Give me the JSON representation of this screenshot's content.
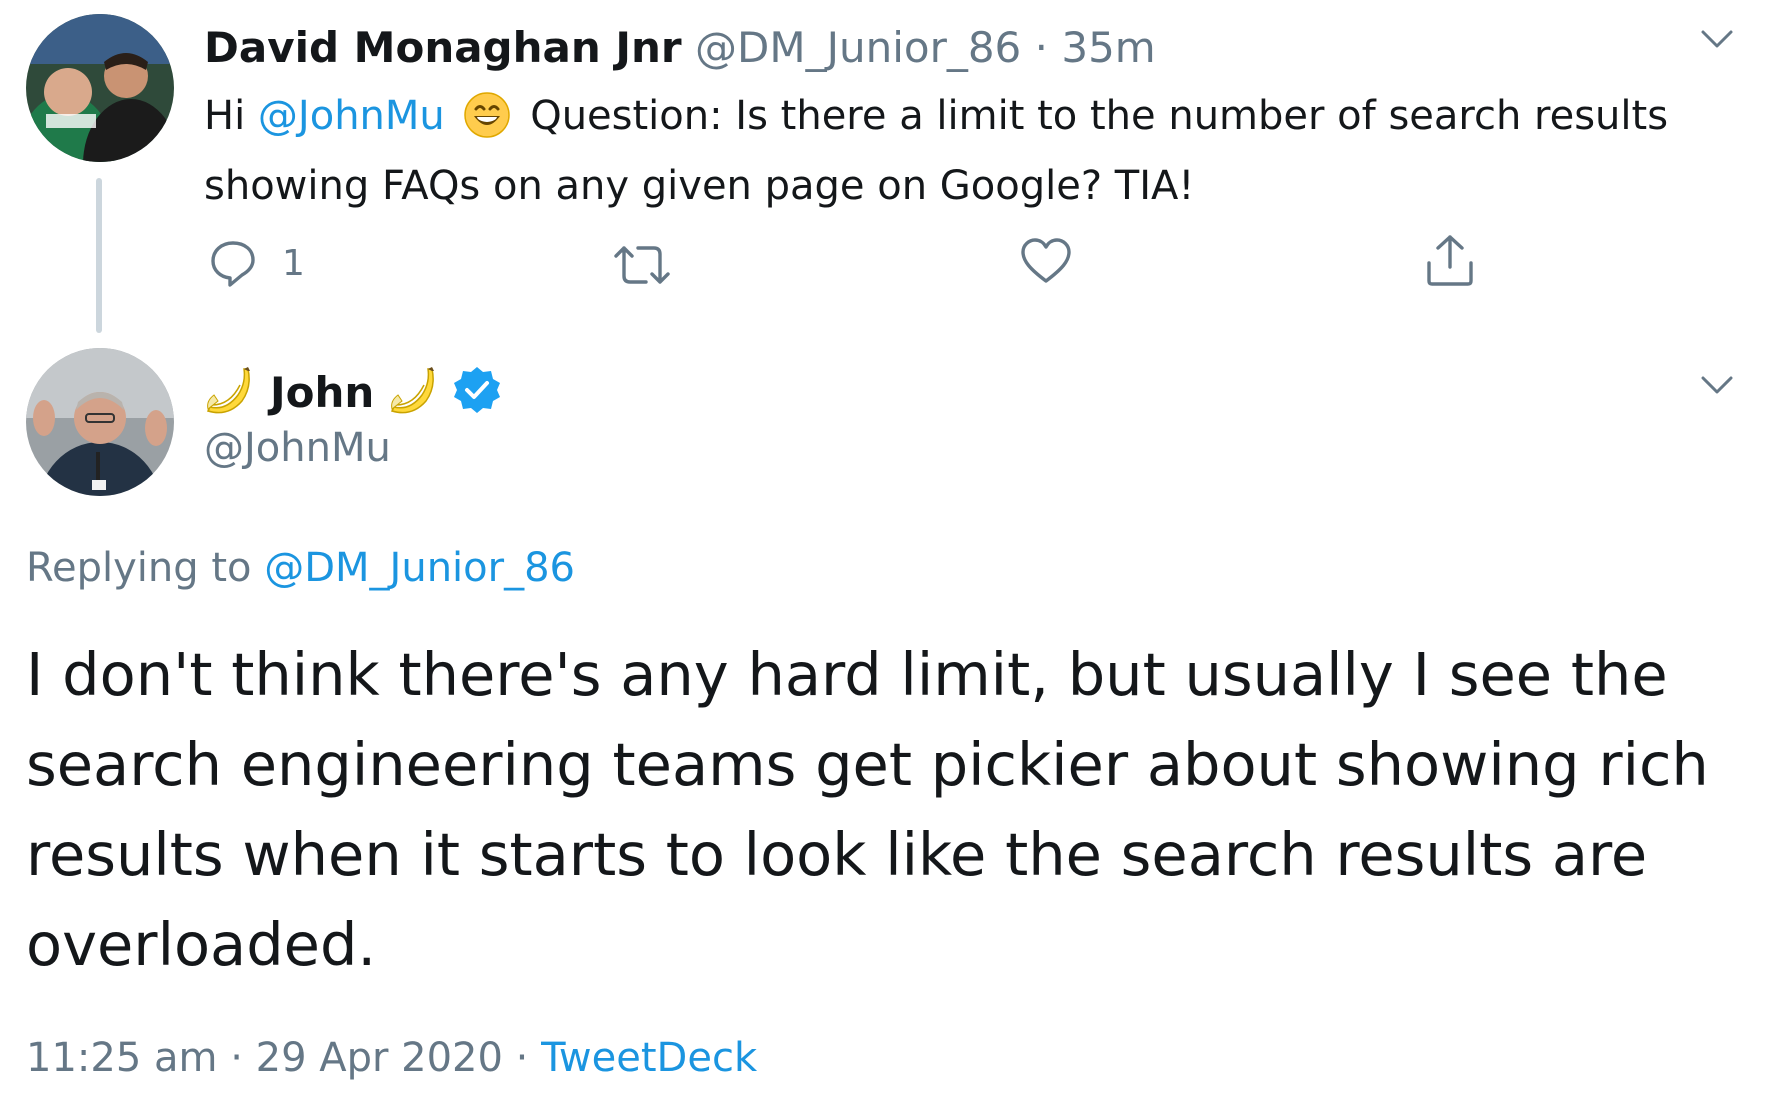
{
  "parent_tweet": {
    "display_name": "David Monaghan Jnr",
    "handle": "@DM_Junior_86",
    "separator": "·",
    "time": "35m",
    "text_hi": "Hi",
    "text_mention": "@JohnMu",
    "emoji": "grinning-face-with-smiling-eyes",
    "text_body": "Question: Is there a limit to the number of search results showing FAQs on any given page on Google? TIA!",
    "reply_count": "1"
  },
  "main_tweet": {
    "display_name": "John",
    "name_emoji": "banana",
    "verified": true,
    "handle": "@JohnMu",
    "replying_prefix": "Replying to",
    "replying_to": "@DM_Junior_86",
    "text": "I don't think there's any hard limit, but usually I see the search engineering teams get pickier about showing rich results when it starts to look like the search results are overloaded.",
    "time": "11:25 am",
    "separator": "·",
    "date": "29 Apr 2020",
    "source": "TweetDeck"
  },
  "colors": {
    "text": "#14171a",
    "secondary": "#657786",
    "link": "#1b95e0",
    "thread_line": "#ccd6dd",
    "verified": "#1da1f2"
  }
}
